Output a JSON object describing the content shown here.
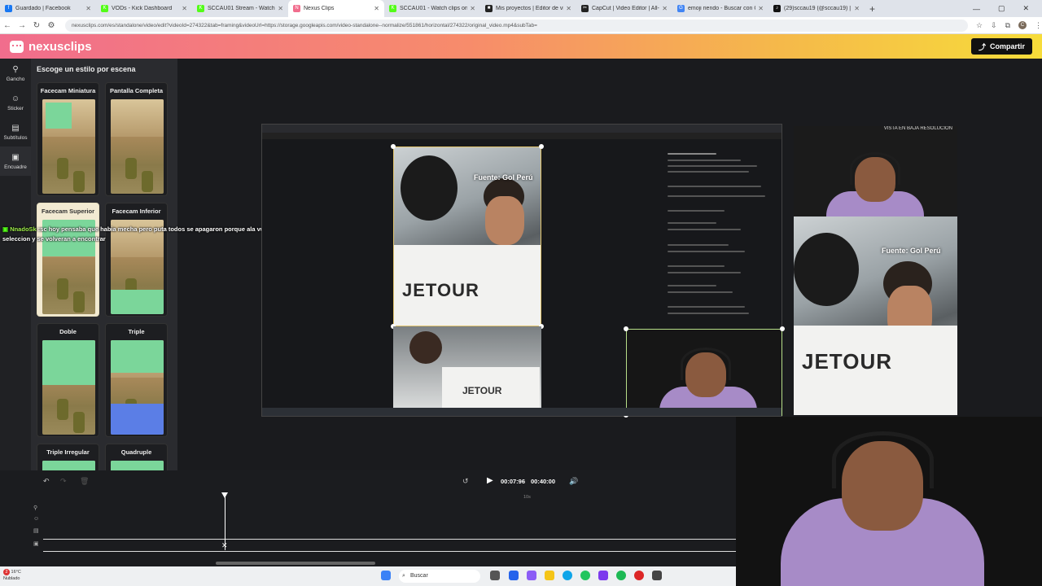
{
  "browser": {
    "tabs": [
      {
        "title": "Guardado | Facebook",
        "color": "#1877f2",
        "glyph": "f"
      },
      {
        "title": "VODs - Kick Dashboard",
        "color": "#53fc18",
        "glyph": "K"
      },
      {
        "title": "SCCAU01 Stream - Watch Live...",
        "color": "#53fc18",
        "glyph": "K"
      },
      {
        "title": "Nexus Clips",
        "color": "#f16d8d",
        "glyph": "N"
      },
      {
        "title": "SCCAU01 - Watch clips on Kick",
        "color": "#53fc18",
        "glyph": "K"
      },
      {
        "title": "Mis proyectos | Editor de video...",
        "color": "#222222",
        "glyph": "■"
      },
      {
        "title": "CapCut | Video Editor | All-In-O...",
        "color": "#222222",
        "glyph": "✂"
      },
      {
        "title": "emoji riendo - Buscar con Goo...",
        "color": "#4285f4",
        "glyph": "G"
      },
      {
        "title": "(29)sccau19 (@sccau19) | TikTok",
        "color": "#111111",
        "glyph": "♪"
      }
    ],
    "active_tab": 3,
    "new_tab": "+",
    "url": "nexusclips.com/es/standalone/video/edit?videoId=274322&tab=framing&videoUrl=https://storage.googleapis.com/video-standalone--normalize/551861/horizontal/274322/original_video.mp4&subTab=",
    "avatar_letter": "C"
  },
  "app": {
    "logo": "nexusclips",
    "share_label": "Compartir"
  },
  "rail": [
    {
      "label": "Gancho",
      "icon": "hook-icon",
      "glyph": "⚲"
    },
    {
      "label": "Sticker",
      "icon": "sticker-icon",
      "glyph": "☺"
    },
    {
      "label": "Subtítulos",
      "icon": "subtitles-icon",
      "glyph": "▤"
    },
    {
      "label": "Encuadre",
      "icon": "frame-icon",
      "glyph": "▣"
    }
  ],
  "panel": {
    "title": "Escoge un estilo por escena",
    "styles": [
      {
        "name": "Facecam Miniatura"
      },
      {
        "name": "Pantalla Completa"
      },
      {
        "name": "Facecam Superior"
      },
      {
        "name": "Facecam Inferior"
      },
      {
        "name": "Doble"
      },
      {
        "name": "Triple"
      },
      {
        "name": "Triple Irregular"
      },
      {
        "name": "Quadruple"
      }
    ],
    "selected": 2
  },
  "chat": {
    "user": "NnadoSk",
    "message": ":sc hoy pensaba que habia mecha pero puta todos se apagaron porque ala vuelta esta la seleccion y se volveran a encontrar"
  },
  "preview": {
    "source_label": "Fuente: Gol Perú",
    "jersey_text": "JETOUR",
    "lowres_label": "VISTA EN BAJA RESOLUCIÓN"
  },
  "timeline": {
    "current_time": "00:07:96",
    "total_time": "00:40:00",
    "tick_label": "10s"
  },
  "taskbar": {
    "weather_temp": "16°C",
    "weather_desc": "Nublado",
    "search_label": "Buscar",
    "notif_count": "2"
  }
}
